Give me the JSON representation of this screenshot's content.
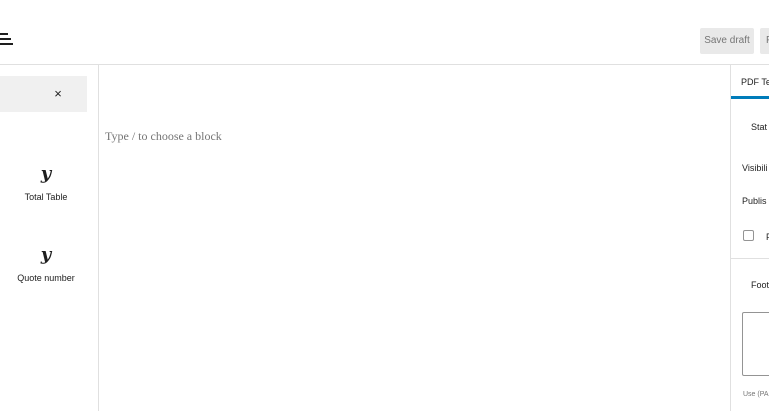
{
  "header": {
    "list_view_icon": "list-view-icon",
    "save_draft_label": "Save draft",
    "publish_label_partial": "P"
  },
  "inserter": {
    "close_icon": "×",
    "blocks": [
      {
        "icon_glyph": "y",
        "label": "Total Table"
      },
      {
        "icon_glyph": "y",
        "label": "Quote number"
      }
    ]
  },
  "editor": {
    "placeholder": "Type / to choose a block"
  },
  "settings_sidebar": {
    "tab_label": "PDF Te",
    "status_heading": "Stat",
    "visibility_label": "Visibili",
    "publish_label": "Publis",
    "checkbox_label": "P",
    "footer_heading": "Foot",
    "help_text": "Use (PA"
  },
  "colors": {
    "accent": "#007cba",
    "border": "#e0e0e0",
    "search_bg": "#f0f0f0",
    "button_bg": "#e9e9e9",
    "muted_text": "#757575"
  }
}
